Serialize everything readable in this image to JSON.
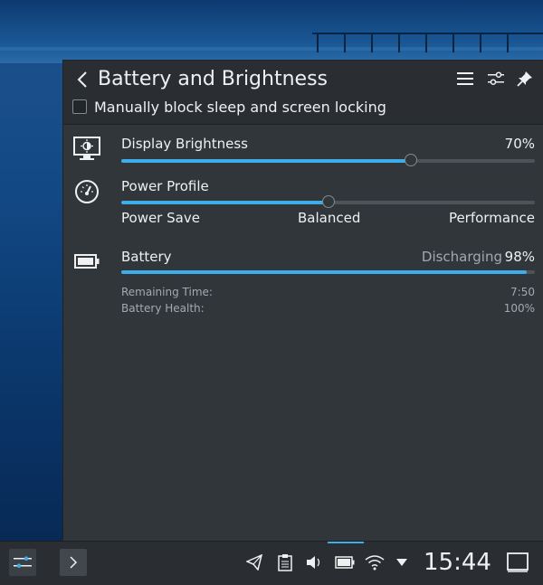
{
  "panel": {
    "title": "Battery and Brightness",
    "inhibit_label": "Manually block sleep and screen locking",
    "inhibit_checked": false
  },
  "brightness": {
    "label": "Display Brightness",
    "value_text": "70%",
    "level": 0.7
  },
  "power_profile": {
    "label": "Power Profile",
    "options": [
      "Power Save",
      "Balanced",
      "Performance"
    ],
    "selected": "Balanced"
  },
  "battery": {
    "label": "Battery",
    "status": "Discharging",
    "percent_text": "98%",
    "level": 0.98,
    "remaining_label": "Remaining Time:",
    "remaining_value": "7:50",
    "health_label": "Battery Health:",
    "health_value": "100%"
  },
  "taskbar": {
    "time": "15:44"
  },
  "colors": {
    "accent": "#3daee9",
    "panel_bg": "#31363b",
    "header_bg": "#2a2e32"
  }
}
